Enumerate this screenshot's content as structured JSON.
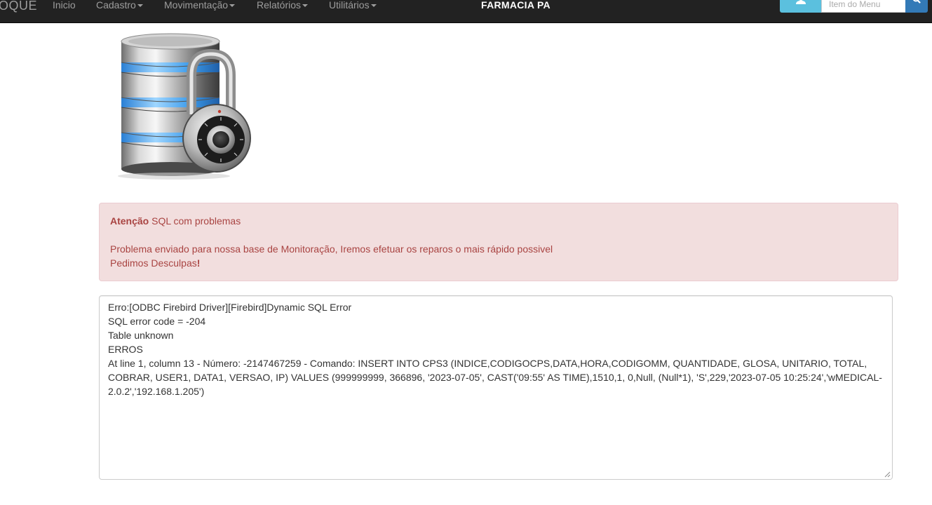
{
  "navbar": {
    "brand": "OQUE",
    "items": [
      {
        "label": "Inicio",
        "dropdown": false
      },
      {
        "label": "Cadastro",
        "dropdown": true
      },
      {
        "label": "Movimentação",
        "dropdown": true
      },
      {
        "label": "Relatórios",
        "dropdown": true
      },
      {
        "label": "Utilitários",
        "dropdown": true
      }
    ],
    "title": "FARMACIA PA",
    "user_icon": "user-icon",
    "search": {
      "placeholder": "Item do Menu",
      "value": "",
      "button_icon": "search-icon"
    }
  },
  "image": {
    "icon": "database-lock-icon"
  },
  "alert": {
    "strong": "Atenção",
    "heading_rest": " SQL com problemas",
    "message": "Problema enviado para nossa base de Monitoração, Iremos efetuar os reparos o mais rápido possivel",
    "apology_text": "Pedimos Desculpas",
    "apology_mark": "!"
  },
  "error": {
    "lines": [
      "Erro:[ODBC Firebird Driver][Firebird]Dynamic SQL Error",
      "SQL error code = -204",
      "Table unknown",
      "ERROS",
      "At line 1, column 13 - Número: -2147467259 - Comando: INSERT INTO CPS3 (INDICE,CODIGOCPS,DATA,HORA,CODIGOMM, QUANTIDADE, GLOSA, UNITARIO, TOTAL, COBRAR, USER1, DATA1, VERSAO, IP) VALUES (999999999, 366896, '2023-07-05', CAST('09:55' AS TIME),1510,1, 0,Null, (Null*1), 'S',229,'2023-07-05 10:25:24','wMEDICAL-2.0.2','192.168.1.205')"
    ]
  },
  "colors": {
    "navbar_bg": "#222222",
    "nav_text": "#9d9d9d",
    "alert_bg": "#f2dede",
    "alert_text": "#a94442",
    "user_button": "#5bc0de",
    "search_button": "#337ab7"
  }
}
